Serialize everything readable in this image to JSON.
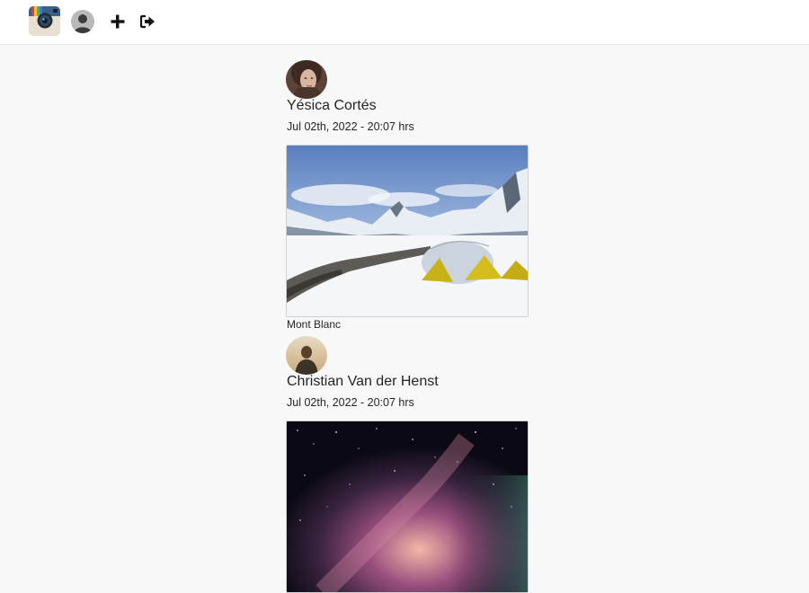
{
  "navbar": {
    "logo_icon": "instagram-camera-logo",
    "profile_icon": "user-avatar-icon",
    "add_icon": "plus-icon",
    "logout_icon": "sign-out-icon"
  },
  "posts": [
    {
      "author": "Yésica Cortés",
      "date": "Jul 02th, 2022 - 20:07 hrs",
      "caption": "Mont Blanc",
      "image": "snowy-mountain-camp-photo"
    },
    {
      "author": "Christian Van der Henst",
      "date": "Jul 02th, 2022 - 20:07 hrs",
      "caption": "",
      "image": "milky-way-night-sky-photo"
    }
  ]
}
